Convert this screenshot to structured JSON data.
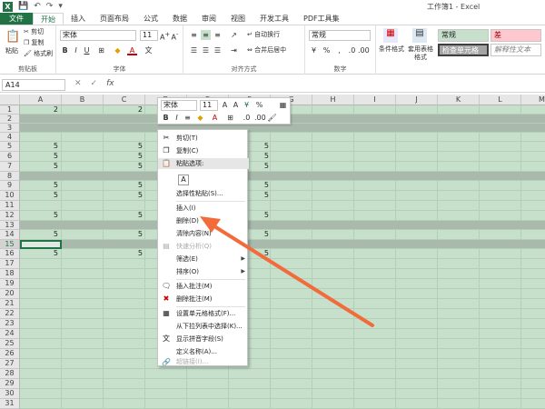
{
  "window_title": "工作簿1 - Excel",
  "tabs": [
    "文件",
    "开始",
    "插入",
    "页面布局",
    "公式",
    "数据",
    "审阅",
    "视图",
    "开发工具",
    "PDF工具集"
  ],
  "ribbon": {
    "clipboard": {
      "paste": "粘贴",
      "cut": "剪切",
      "copy": "复制",
      "format_painter": "格式刷",
      "label": "剪贴板"
    },
    "font": {
      "name": "宋体",
      "size": "11",
      "label": "字体",
      "bold": "B",
      "italic": "I",
      "underline": "U"
    },
    "alignment": {
      "wrap": "自动换行",
      "merge": "合并后居中",
      "label": "对齐方式"
    },
    "number": {
      "format": "常规",
      "label": "数字",
      "percent": "%"
    },
    "styles": {
      "conditional": "条件格式",
      "table": "套用表格格式",
      "normal": "常规",
      "bad": "差",
      "check": "检查单元格",
      "explain": "解释性文本"
    }
  },
  "formula_bar": {
    "namebox": "A14",
    "fx": "fx"
  },
  "columns": [
    "A",
    "B",
    "C",
    "D",
    "E",
    "F",
    "G",
    "H",
    "I",
    "J",
    "K",
    "L",
    "M"
  ],
  "rows": [
    "1",
    "2",
    "3",
    "4",
    "5",
    "6",
    "7",
    "8",
    "9",
    "10",
    "11",
    "12",
    "13",
    "14",
    "15",
    "16",
    "17",
    "18",
    "19",
    "20",
    "21",
    "22",
    "23",
    "24",
    "25",
    "26",
    "27",
    "28",
    "29",
    "30",
    "31"
  ],
  "cells": {
    "r1": [
      "2",
      "2"
    ],
    "r5": [
      "5",
      "5",
      "5"
    ],
    "r6": [
      "5",
      "5",
      "5"
    ],
    "r7": [
      "5",
      "5",
      "5"
    ],
    "r9": [
      "5",
      "5",
      "5"
    ],
    "r10": [
      "5",
      "5",
      "5"
    ],
    "r12": [
      "5",
      "5",
      "5"
    ],
    "r14": [
      "5",
      "5",
      "5"
    ],
    "r16": [
      "5",
      "5",
      "5"
    ]
  },
  "mini_toolbar": {
    "font": "宋体",
    "size": "11",
    "percent": "%"
  },
  "context_menu": {
    "cut": "剪切(T)",
    "copy": "复制(C)",
    "paste_options": "粘贴选项:",
    "paste_special": "选择性粘贴(S)...",
    "insert": "插入(I)",
    "delete": "删除(D)",
    "clear": "清除内容(N)",
    "quick_analysis": "快速分析(Q)",
    "filter": "筛选(E)",
    "sort": "排序(O)",
    "insert_comment": "插入批注(M)",
    "delete_comment": "删除批注(M)",
    "format_cells": "设置单元格格式(F)...",
    "pick_list": "从下拉列表中选择(K)...",
    "phonetic": "显示拼音字段(S)",
    "define_name": "定义名称(A)...",
    "hyperlink": "超链接(I)..."
  },
  "colors": {
    "accent": "#217346",
    "arrow": "#f26b3a",
    "sheet_bg": "#c6e0cc"
  }
}
